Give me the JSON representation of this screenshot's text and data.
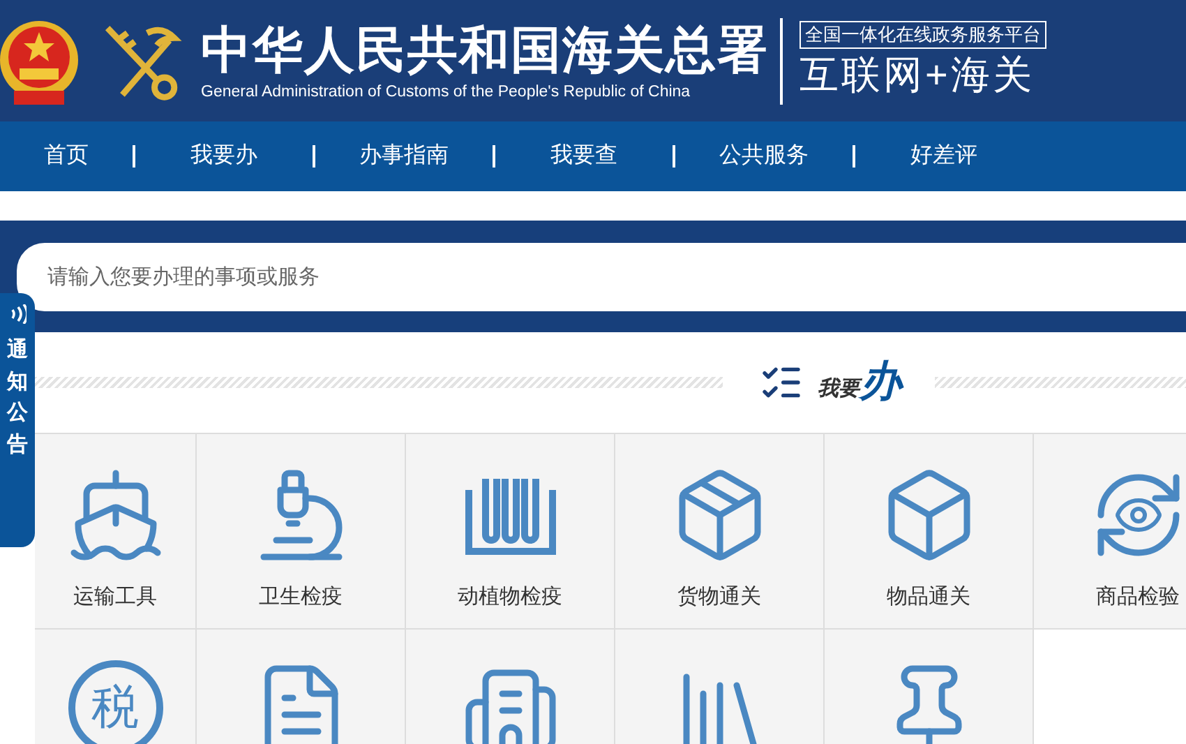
{
  "header": {
    "title": "中华人民共和国海关总署",
    "subtitle": "General Administration of Customs of the People's Republic of China",
    "platform_caption": "全国一体化在线政务服务平台",
    "platform_name": "互联网+海关"
  },
  "nav": [
    {
      "label": "首页"
    },
    {
      "label": "我要办"
    },
    {
      "label": "办事指南"
    },
    {
      "label": "我要查"
    },
    {
      "label": "公共服务"
    },
    {
      "label": "好差评"
    }
  ],
  "search": {
    "placeholder": "请输入您要办理的事项或服务"
  },
  "side_tab": {
    "label": "通知公告"
  },
  "section": {
    "title_prefix": "我要",
    "title_main": "办"
  },
  "services": [
    {
      "kind": "ship",
      "label": "运输工具"
    },
    {
      "kind": "microscope",
      "label": "卫生检疫"
    },
    {
      "kind": "tubes",
      "label": "动植物检疫"
    },
    {
      "kind": "parcel",
      "label": "货物通关"
    },
    {
      "kind": "box",
      "label": "物品通关"
    },
    {
      "kind": "eye",
      "label": "商品检验"
    },
    {
      "kind": "tax",
      "glyph": "税"
    },
    {
      "kind": "document"
    },
    {
      "kind": "building"
    },
    {
      "kind": "books"
    },
    {
      "kind": "pin"
    },
    {
      "kind": "empty"
    }
  ]
}
